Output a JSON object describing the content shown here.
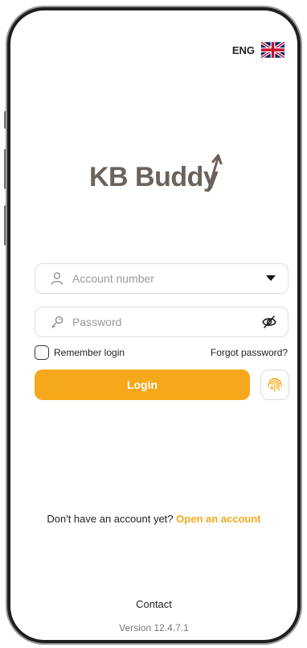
{
  "language": {
    "label": "ENG",
    "flag_icon": "uk-flag-icon"
  },
  "brand": {
    "logo_text": "KB Buddy"
  },
  "form": {
    "account_placeholder": "Account number",
    "password_placeholder": "Password",
    "remember_label": "Remember login",
    "remember_checked": false,
    "forgot_label": "Forgot password?",
    "login_label": "Login"
  },
  "signup": {
    "question": "Don't have an account yet?",
    "link": "Open an account"
  },
  "footer": {
    "contact": "Contact",
    "version": "Version 12.4.7.1"
  },
  "colors": {
    "accent": "#f5a81b",
    "logo": "#6b625b",
    "border": "#dcdcdc"
  }
}
